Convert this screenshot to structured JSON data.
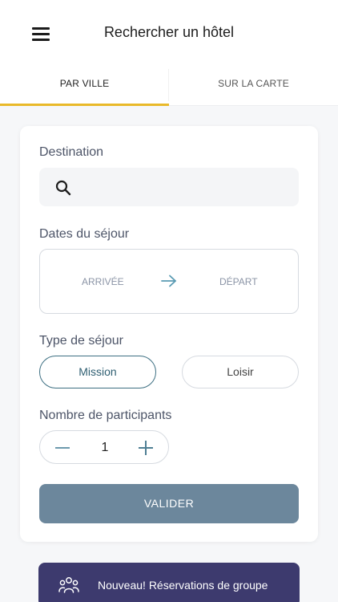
{
  "header": {
    "title": "Rechercher un hôtel",
    "menu_icon": "hamburger-menu-icon"
  },
  "tabs": [
    {
      "label": "PAR VILLE",
      "active": true
    },
    {
      "label": "SUR LA CARTE",
      "active": false
    }
  ],
  "form": {
    "destination": {
      "label": "Destination",
      "value": "",
      "placeholder": "",
      "icon": "search-icon"
    },
    "dates": {
      "label": "Dates du séjour",
      "arrival": "ARRIVÉE",
      "departure": "DÉPART",
      "icon": "arrow-right-icon"
    },
    "stay_type": {
      "label": "Type de séjour",
      "options": [
        {
          "label": "Mission",
          "selected": true
        },
        {
          "label": "Loisir",
          "selected": false
        }
      ]
    },
    "participants": {
      "label": "Nombre de participants",
      "value": "1"
    },
    "submit_label": "VALIDER"
  },
  "banner": {
    "text": "Nouveau! Réservations de groupe",
    "icon": "group-people-icon"
  },
  "colors": {
    "active_tab_underline": "#e9b92a",
    "primary": "#3d6f82",
    "submit_button": "#6c879c",
    "banner_background": "#3d3a6e"
  }
}
